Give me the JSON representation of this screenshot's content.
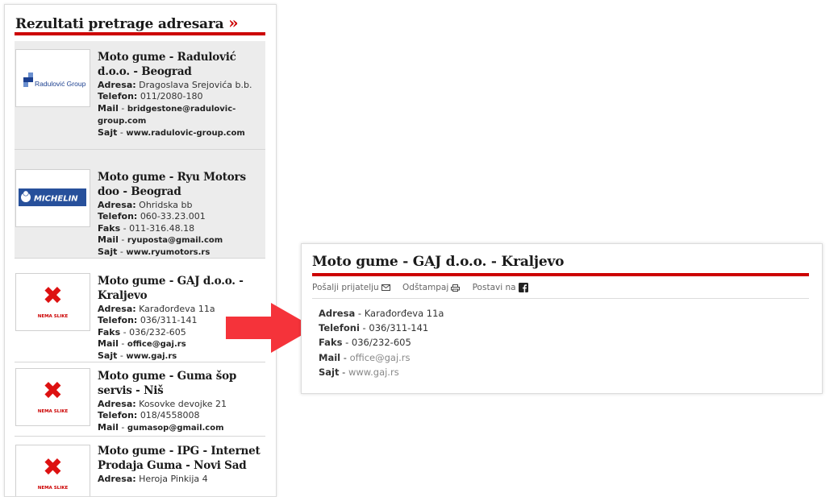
{
  "results": {
    "title": "Rezultati pretrage adresara",
    "title_suffix": "»",
    "items": [
      {
        "name": "Moto gume - Radulović d.o.o. - Beograd",
        "logo": "radulovic-group-logo",
        "logo_text": "Radulović Group",
        "adresa_label": "Adresa:",
        "adresa": "Dragoslava Srejovića b.b.",
        "telefon_label": "Telefon:",
        "telefon": "011/2080-180",
        "mail_label": "Mail",
        "mail": "bridgestone@radulovic-group.com",
        "sajt_label": "Sajt",
        "sajt": "www.radulovic-group.com"
      },
      {
        "name": "Moto gume - Ryu Motors doo - Beograd",
        "logo": "michelin-logo",
        "logo_text": "MICHELIN",
        "adresa_label": "Adresa:",
        "adresa": "Ohridska bb",
        "telefon_label": "Telefon:",
        "telefon": "060-33.23.001",
        "faks_label": "Faks",
        "faks": "011-316.48.18",
        "mail_label": "Mail",
        "mail": "ryuposta@gmail.com",
        "sajt_label": "Sajt",
        "sajt": "www.ryumotors.rs"
      },
      {
        "name": "Moto gume - GAJ d.o.o. - Kraljevo",
        "logo": "no-image",
        "logo_text": "NEMA SLIKE",
        "adresa_label": "Adresa:",
        "adresa": "Karađorđeva 11a",
        "telefon_label": "Telefon:",
        "telefon": "036/311-141",
        "faks_label": "Faks",
        "faks": "036/232-605",
        "mail_label": "Mail",
        "mail": "office@gaj.rs",
        "sajt_label": "Sajt",
        "sajt": "www.gaj.rs"
      },
      {
        "name": "Moto gume - Guma šop servis - Niš",
        "logo": "no-image",
        "logo_text": "NEMA SLIKE",
        "adresa_label": "Adresa:",
        "adresa": "Kosovke devojke 21",
        "telefon_label": "Telefon:",
        "telefon": "018/4558008",
        "mail_label": "Mail",
        "mail": "gumasop@gmail.com"
      },
      {
        "name": "Moto gume - IPG - Internet Prodaja Guma - Novi Sad",
        "logo": "no-image",
        "logo_text": "NEMA SLIKE",
        "adresa_label": "Adresa:",
        "adresa": "Heroja Pinkija 4"
      }
    ]
  },
  "detail": {
    "title": "Moto gume - GAJ d.o.o. - Kraljevo",
    "actions": {
      "send": "Pošalji prijatelju",
      "print": "Odštampaj",
      "post": "Postavi na"
    },
    "rows": {
      "adresa_label": "Adresa",
      "adresa": "Karađorđeva 11a",
      "telefoni_label": "Telefoni",
      "telefoni": "036/311-141",
      "faks_label": "Faks",
      "faks": "036/232-605",
      "mail_label": "Mail",
      "mail": "office@gaj.rs",
      "sajt_label": "Sajt",
      "sajt": "www.gaj.rs"
    }
  },
  "colors": {
    "accent": "#cc0000",
    "arrow": "#f5333a",
    "shaded": "#ececec"
  }
}
